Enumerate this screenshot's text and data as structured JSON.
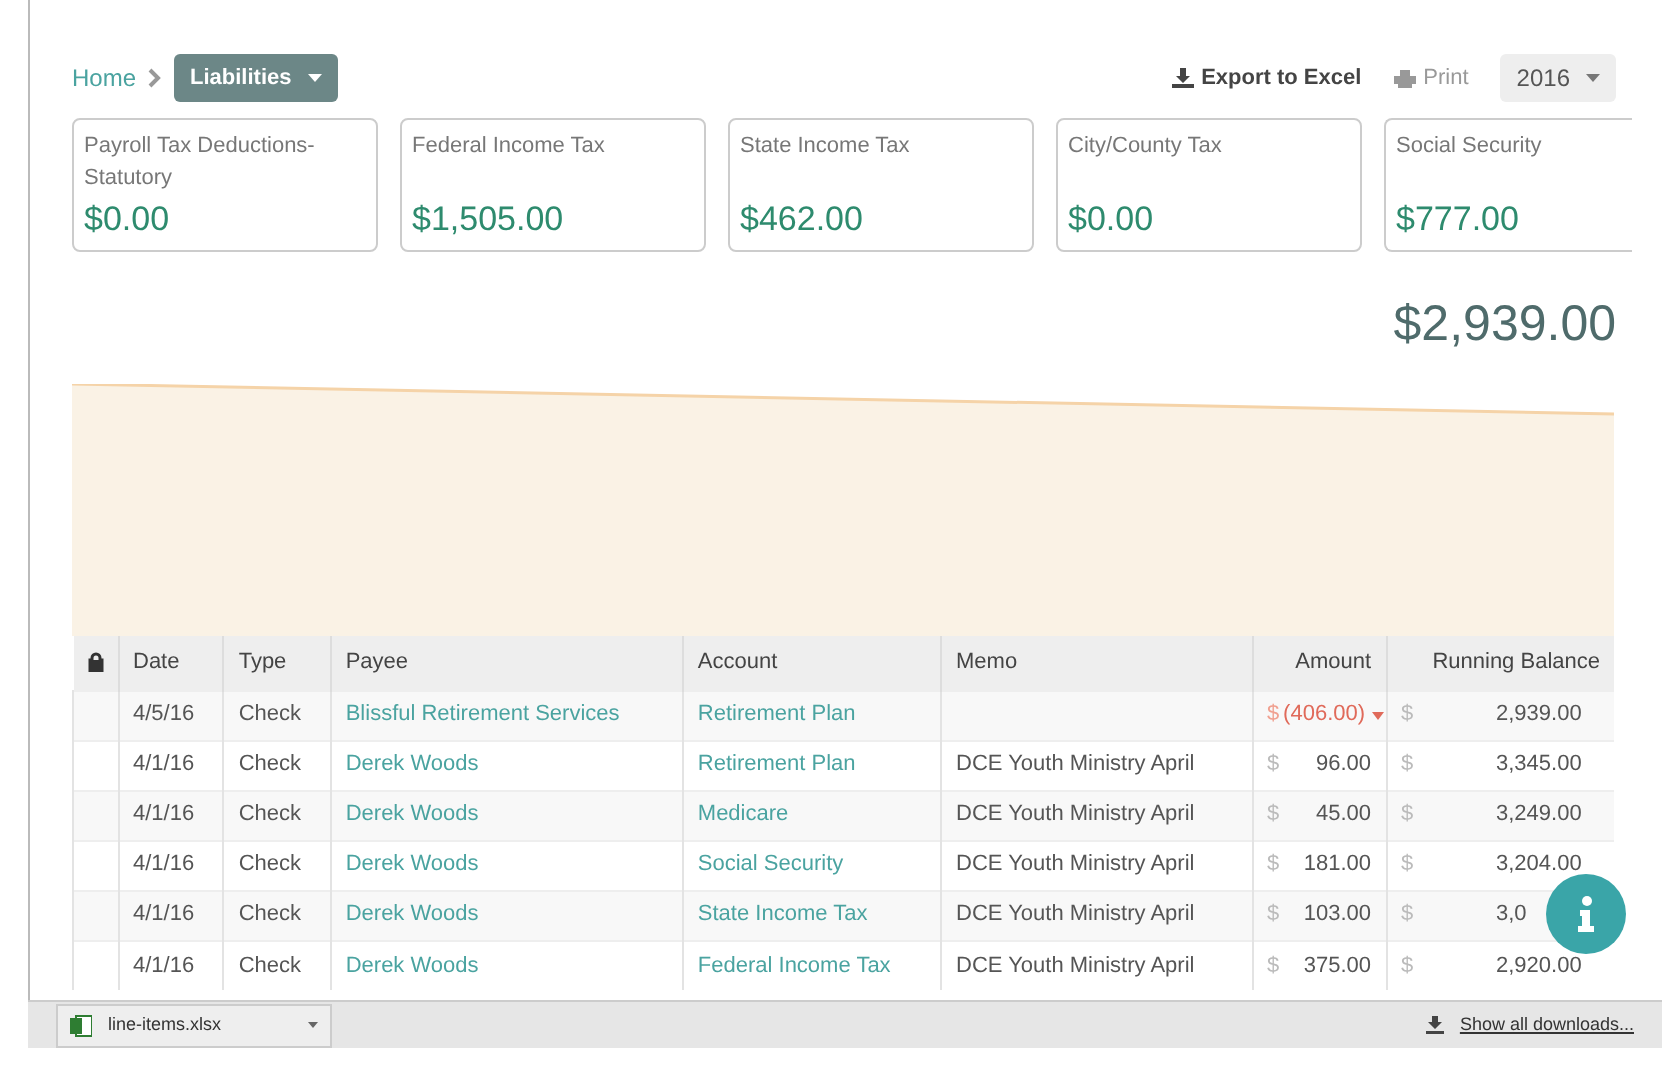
{
  "breadcrumb": {
    "home": "Home",
    "current": "Liabilities"
  },
  "toolbar": {
    "export": "Export to Excel",
    "print": "Print",
    "year": "2016"
  },
  "cards": [
    {
      "title": "Payroll Tax Deductions-Statutory",
      "amount": "$0.00"
    },
    {
      "title": "Federal Income Tax",
      "amount": "$1,505.00"
    },
    {
      "title": "State Income Tax",
      "amount": "$462.00"
    },
    {
      "title": "City/County Tax",
      "amount": "$0.00"
    },
    {
      "title": "Social Security",
      "amount": "$777.00"
    }
  ],
  "total": "$2,939.00",
  "table": {
    "columns": [
      "Date",
      "Type",
      "Payee",
      "Account",
      "Memo",
      "Amount",
      "Running Balance"
    ],
    "rows": [
      {
        "date": "4/5/16",
        "type": "Check",
        "payee": "Blissful Retirement Services",
        "account": "Retirement Plan",
        "memo": "",
        "amount_symbol": "$",
        "amount": "(406.00)",
        "negative": true,
        "balance_symbol": "$",
        "balance": "2,939.00"
      },
      {
        "date": "4/1/16",
        "type": "Check",
        "payee": "Derek Woods",
        "account": "Retirement Plan",
        "memo": "DCE Youth Ministry April",
        "amount_symbol": "$",
        "amount": "96.00",
        "negative": false,
        "balance_symbol": "$",
        "balance": "3,345.00"
      },
      {
        "date": "4/1/16",
        "type": "Check",
        "payee": "Derek Woods",
        "account": "Medicare",
        "memo": "DCE Youth Ministry April",
        "amount_symbol": "$",
        "amount": "45.00",
        "negative": false,
        "balance_symbol": "$",
        "balance": "3,249.00"
      },
      {
        "date": "4/1/16",
        "type": "Check",
        "payee": "Derek Woods",
        "account": "Social Security",
        "memo": "DCE Youth Ministry April",
        "amount_symbol": "$",
        "amount": "181.00",
        "negative": false,
        "balance_symbol": "$",
        "balance": "3,204.00"
      },
      {
        "date": "4/1/16",
        "type": "Check",
        "payee": "Derek Woods",
        "account": "State Income Tax",
        "memo": "DCE Youth Ministry April",
        "amount_symbol": "$",
        "amount": "103.00",
        "negative": false,
        "balance_symbol": "$",
        "balance": "3,0"
      },
      {
        "date": "4/1/16",
        "type": "Check",
        "payee": "Derek Woods",
        "account": "Federal Income Tax",
        "memo": "DCE Youth Ministry April",
        "amount_symbol": "$",
        "amount": "375.00",
        "negative": false,
        "balance_symbol": "$",
        "balance": "2,920.00"
      }
    ]
  },
  "download_bar": {
    "file": "line-items.xlsx",
    "show_all": "Show all downloads..."
  }
}
